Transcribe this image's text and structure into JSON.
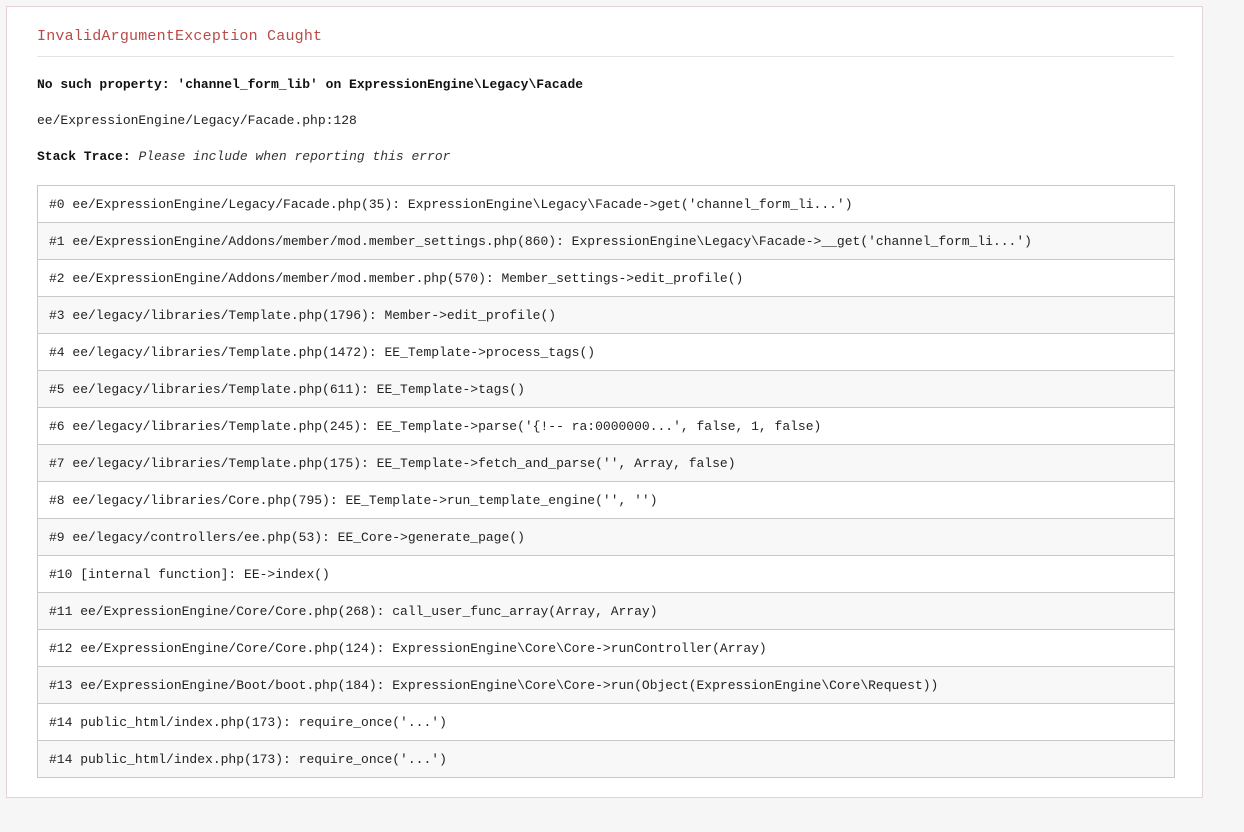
{
  "error": {
    "title": "InvalidArgumentException Caught",
    "message": "No such property: 'channel_form_lib' on ExpressionEngine\\Legacy\\Facade",
    "location": "ee/ExpressionEngine/Legacy/Facade.php:128",
    "stack_trace_label": "Stack Trace:",
    "stack_trace_note": "Please include when reporting this error"
  },
  "trace": [
    "#0 ee/ExpressionEngine/Legacy/Facade.php(35): ExpressionEngine\\Legacy\\Facade->get('channel_form_li...')",
    "#1 ee/ExpressionEngine/Addons/member/mod.member_settings.php(860): ExpressionEngine\\Legacy\\Facade->__get('channel_form_li...')",
    "#2 ee/ExpressionEngine/Addons/member/mod.member.php(570): Member_settings->edit_profile()",
    "#3 ee/legacy/libraries/Template.php(1796): Member->edit_profile()",
    "#4 ee/legacy/libraries/Template.php(1472): EE_Template->process_tags()",
    "#5 ee/legacy/libraries/Template.php(611): EE_Template->tags()",
    "#6 ee/legacy/libraries/Template.php(245): EE_Template->parse('{!-- ra:0000000...', false, 1, false)",
    "#7 ee/legacy/libraries/Template.php(175): EE_Template->fetch_and_parse('', Array, false)",
    "#8 ee/legacy/libraries/Core.php(795): EE_Template->run_template_engine('', '')",
    "#9 ee/legacy/controllers/ee.php(53): EE_Core->generate_page()",
    "#10 [internal function]: EE->index()",
    "#11 ee/ExpressionEngine/Core/Core.php(268): call_user_func_array(Array, Array)",
    "#12 ee/ExpressionEngine/Core/Core.php(124): ExpressionEngine\\Core\\Core->runController(Array)",
    "#13 ee/ExpressionEngine/Boot/boot.php(184): ExpressionEngine\\Core\\Core->run(Object(ExpressionEngine\\Core\\Request))",
    "#14 public_html/index.php(173): require_once('...')",
    "#14 public_html/index.php(173): require_once('...')"
  ],
  "colors": {
    "title": "#b94a48",
    "background": "#f6f6f6",
    "row_alt": "#f8f8f8"
  }
}
